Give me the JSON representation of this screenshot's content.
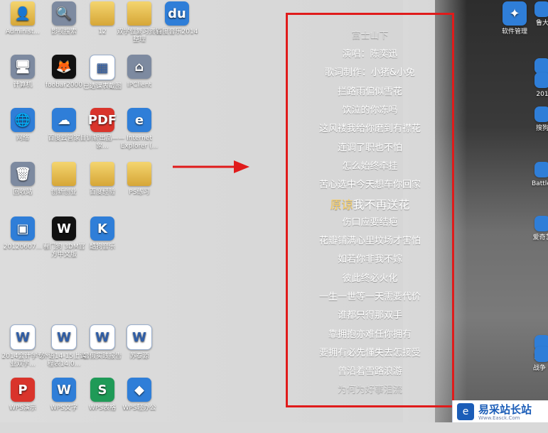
{
  "desktop": {
    "icons": [
      {
        "label": "Administ...",
        "kind": "folder",
        "glyph": "👤"
      },
      {
        "label": "影视搜索",
        "kind": "gray",
        "glyph": "🔍"
      },
      {
        "label": "12",
        "kind": "folder",
        "glyph": ""
      },
      {
        "label": "双学位复习资料整理",
        "kind": "folder",
        "glyph": ""
      },
      {
        "label": "百度音乐2014",
        "kind": "blue",
        "glyph": "du"
      },
      {
        "label": "计算机",
        "kind": "gray",
        "glyph": "🖥"
      },
      {
        "label": "foobar2000",
        "kind": "black",
        "glyph": "🦊"
      },
      {
        "label": "已选课表截图",
        "kind": "doc",
        "glyph": "▦"
      },
      {
        "label": "IPClient",
        "kind": "gray",
        "glyph": "⌂"
      },
      {
        "label": "网络",
        "kind": "blue",
        "glyph": "🌐"
      },
      {
        "label": "百度云管家",
        "kind": "blue",
        "glyph": "☁"
      },
      {
        "label": "目训斩出品——象...",
        "kind": "red",
        "glyph": "PDF"
      },
      {
        "label": "Internet Explorer (...",
        "kind": "blue",
        "glyph": "e"
      },
      {
        "label": "回收站",
        "kind": "gray",
        "glyph": "🗑"
      },
      {
        "label": "创新创业",
        "kind": "folder",
        "glyph": ""
      },
      {
        "label": "百度经验",
        "kind": "folder",
        "glyph": ""
      },
      {
        "label": "PS练习",
        "kind": "folder",
        "glyph": ""
      },
      {
        "label": "20120607...",
        "kind": "blue",
        "glyph": "▣"
      },
      {
        "label": "看门狗 3DM官方中文版",
        "kind": "black",
        "glyph": "W"
      },
      {
        "label": "酷狗音乐",
        "kind": "blue",
        "glyph": "K"
      },
      {
        "label": "2014会计学专业双学...",
        "kind": "doc",
        "glyph": "W"
      },
      {
        "label": "外语14-15上课程表14.0...",
        "kind": "doc",
        "glyph": "W"
      },
      {
        "label": "暑假实践报告",
        "kind": "doc",
        "glyph": "W"
      },
      {
        "label": "苏泰源",
        "kind": "doc",
        "glyph": "W"
      },
      {
        "label": "WPS演示",
        "kind": "red",
        "glyph": "P"
      },
      {
        "label": "WPS文字",
        "kind": "blue",
        "glyph": "W"
      },
      {
        "label": "WPS表格",
        "kind": "green",
        "glyph": "S"
      },
      {
        "label": "WPS轻办公",
        "kind": "blue",
        "glyph": "◆"
      }
    ],
    "right_icons": [
      {
        "label": "软件管理",
        "glyph": "✦"
      },
      {
        "label": "鲁大",
        "glyph": ""
      },
      {
        "label": "阿里",
        "glyph": ""
      },
      {
        "label": "201",
        "glyph": ""
      },
      {
        "label": "搜狗",
        "glyph": ""
      },
      {
        "label": "Battlefi",
        "glyph": ""
      },
      {
        "label": "爱奇艺",
        "glyph": ""
      },
      {
        "label": "罗马2",
        "glyph": ""
      },
      {
        "label": "战争 v",
        "glyph": ""
      }
    ]
  },
  "lyrics": {
    "title": "富士山下",
    "lines": [
      "演唱：陈奕迅",
      "歌词制作：小猪&小兔",
      "拦路雨偏似雪花",
      "饮泣的你冻吗",
      "这风褛我给你磨到有襟花",
      "连调了职也不怕",
      "怎么始终牵挂",
      "苦心选中今天想车你回家",
      "原谅我不再送花",
      "伤口应要结疤",
      "花瓣铺满心里坟场才害怕",
      "如若你非我不嫁",
      "彼此终必火化",
      "一生一世等一天需要代价",
      "谁都只得那双手",
      "靠拥抱亦难任你拥有",
      "要拥有必先懂失去怎接受",
      "曾沿着雪路浪游",
      "为何为好事泪流"
    ],
    "highlight_prefix": "原谅",
    "highlight_rest": "我不再送花"
  },
  "watermark": {
    "text": "易采站长站",
    "sub": "Www.Easck.Com"
  },
  "colors": {
    "box_border": "#e01b1b",
    "highlight": "#ffd15b",
    "watermark_blue": "#1b5db8"
  }
}
